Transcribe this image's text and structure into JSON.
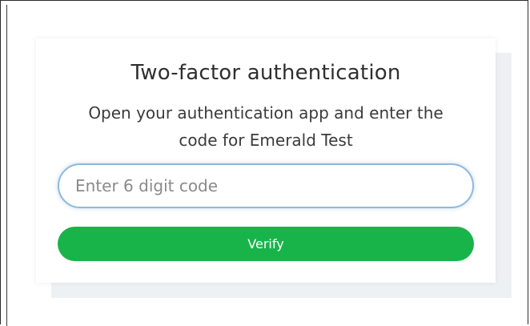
{
  "dialog": {
    "title": "Two-factor authentication",
    "subtitle": "Open your authentication app and enter the code for Emerald Test"
  },
  "code_input": {
    "value": "",
    "placeholder": "Enter 6 digit code"
  },
  "verify_button": {
    "label": "Verify"
  },
  "colors": {
    "accent": "#18b44a",
    "input_focus_border": "#8fb9dc",
    "text": "#2f2f2f"
  }
}
